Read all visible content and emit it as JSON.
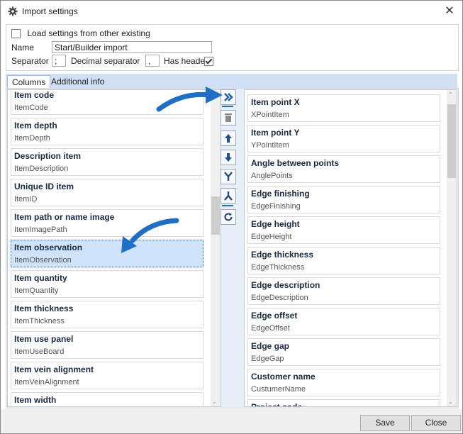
{
  "window": {
    "title": "Import settings",
    "close_glyph": "✕"
  },
  "settings": {
    "load_label": "Load settings from other existing",
    "load_checked": false,
    "name_label": "Name",
    "name_value": "Start/Builder import",
    "separator_label": "Separator",
    "separator_value": ";",
    "decimal_label": "Decimal separator",
    "decimal_value": ",",
    "header_label": "Has header",
    "header_checked": true
  },
  "tabs": [
    {
      "label": "Columns",
      "active": true
    },
    {
      "label": "Additional info",
      "active": false
    }
  ],
  "left_list": [
    {
      "title": "Item code",
      "sub": "ItemCode"
    },
    {
      "title": "Item depth",
      "sub": "ItemDepth"
    },
    {
      "title": "Description item",
      "sub": "ItemDescription"
    },
    {
      "title": "Unique ID item",
      "sub": "ItemID"
    },
    {
      "title": "Item path or name image",
      "sub": "ItemImagePath"
    },
    {
      "title": "Item observation",
      "sub": "ItemObservation",
      "selected": true
    },
    {
      "title": "Item quantity",
      "sub": "ItemQuantity"
    },
    {
      "title": "Item thickness",
      "sub": "ItemThickness"
    },
    {
      "title": "Item use panel",
      "sub": "ItemUseBoard"
    },
    {
      "title": "Item vein alignment",
      "sub": "ItemVeinAlignment"
    },
    {
      "title": "Item width",
      "sub": ""
    }
  ],
  "right_list": [
    {
      "title": "Item point X",
      "sub": "XPointItem"
    },
    {
      "title": "Item point Y",
      "sub": "YPointItem"
    },
    {
      "title": "Angle between points",
      "sub": "AnglePoints"
    },
    {
      "title": "Edge finishing",
      "sub": "EdgeFinishing"
    },
    {
      "title": "Edge height",
      "sub": "EdgeHeight"
    },
    {
      "title": "Edge thickness",
      "sub": "EdgeThickness"
    },
    {
      "title": "Edge description",
      "sub": "EdgeDescription"
    },
    {
      "title": "Edge offset",
      "sub": "EdgeOffset"
    },
    {
      "title": "Edge gap",
      "sub": "EdgeGap"
    },
    {
      "title": "Customer name",
      "sub": "CustumerName"
    },
    {
      "title": "Project code",
      "sub": ""
    }
  ],
  "buttons": {
    "save": "Save",
    "close": "Close"
  },
  "colors": {
    "accent": "#1e6fc7",
    "selection": "#cfe4fa",
    "tabbar": "#cfe0f5"
  }
}
